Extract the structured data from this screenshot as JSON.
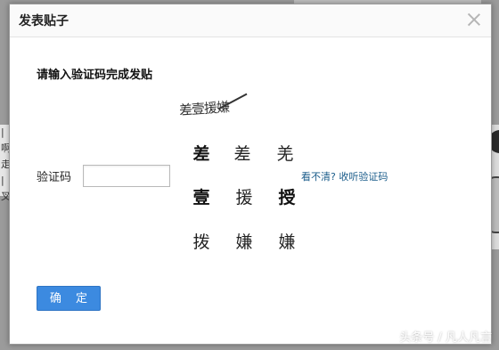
{
  "modal": {
    "title": "发表贴子",
    "instruction": "请输入验证码完成发贴",
    "code_label": "验证码",
    "code_value": "",
    "captcha_hint": "差壹援嫌",
    "captcha_chars": [
      "差",
      "差",
      "羌",
      "壹",
      "援",
      "授",
      "拨",
      "嫌",
      "嫌"
    ],
    "refresh_link": "看不清? 收听验证码",
    "confirm_label": "确 定"
  },
  "background": {
    "left_fragments": [
      "|啊",
      "走。",
      "|叉"
    ]
  },
  "watermark": "头条号 / 凡人凡言",
  "colors": {
    "button_blue": "#3c8ae0",
    "link_blue": "#1a5c8a",
    "backdrop_gray": "#9b9b9b"
  }
}
